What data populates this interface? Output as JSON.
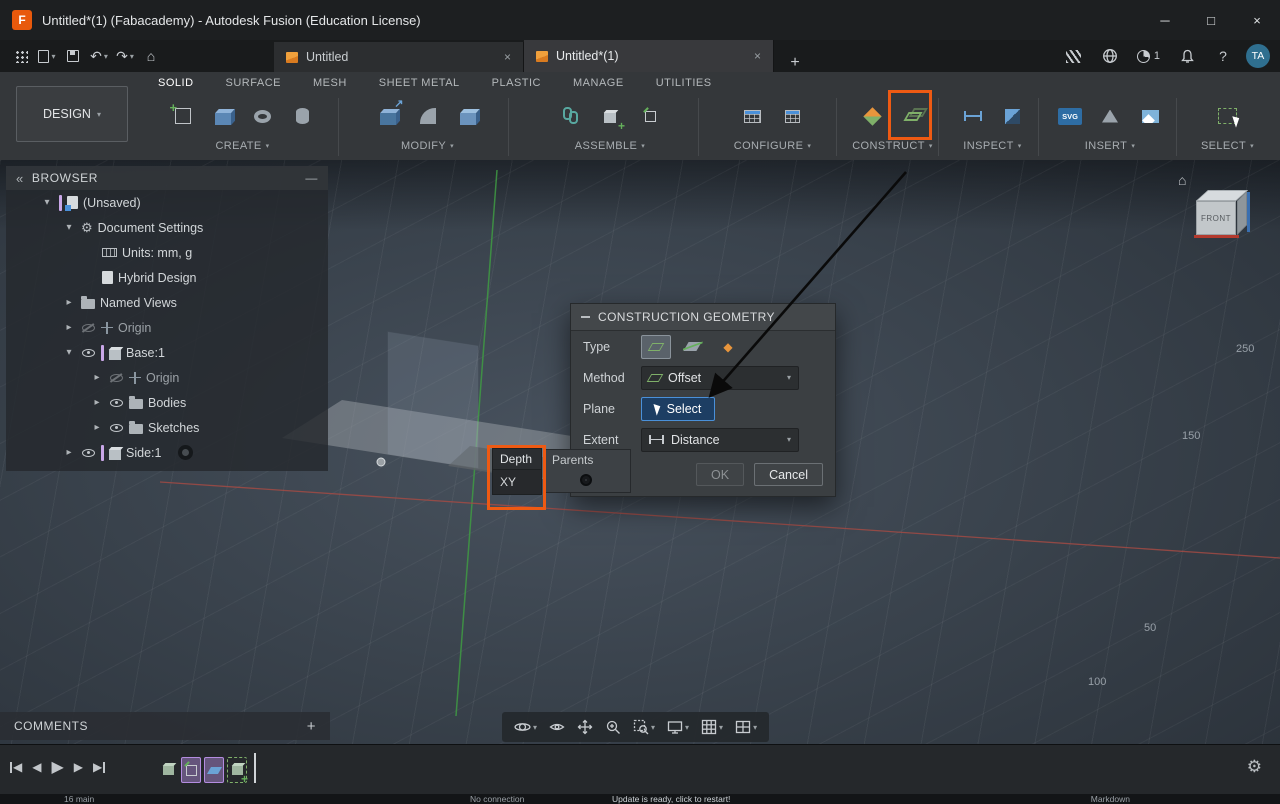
{
  "window": {
    "title": "Untitled*(1) (Fabacademy) - Autodesk Fusion (Education License)",
    "logo_letter": "F"
  },
  "icons": {
    "caret_down": "▾",
    "caret_right": "▸",
    "close": "×",
    "plus": "+",
    "minus": "—",
    "collapse_left": "«",
    "undo": "↶",
    "redo": "↷",
    "home": "⌂",
    "help": "?",
    "gear": "⚙",
    "win_min": "─",
    "win_max": "□",
    "play": "▶",
    "rew": "◀",
    "point": "◆"
  },
  "qat": {
    "tabs": [
      {
        "label": "Untitled"
      },
      {
        "label": "Untitled*(1)"
      }
    ],
    "job_count": "1",
    "avatar": "TA"
  },
  "ribbon": {
    "design_label": "DESIGN",
    "tabs": [
      "SOLID",
      "SURFACE",
      "MESH",
      "SHEET METAL",
      "PLASTIC",
      "MANAGE",
      "UTILITIES"
    ],
    "groups": [
      {
        "label": "CREATE"
      },
      {
        "label": "MODIFY"
      },
      {
        "label": "ASSEMBLE"
      },
      {
        "label": "CONFIGURE"
      },
      {
        "label": "CONSTRUCT"
      },
      {
        "label": "INSPECT"
      },
      {
        "label": "INSERT"
      },
      {
        "label": "SELECT"
      }
    ],
    "svg_badge": "SVG"
  },
  "browser": {
    "header": "BROWSER",
    "items": [
      {
        "label": "(Unsaved)"
      },
      {
        "label": "Document Settings"
      },
      {
        "label": "Units: mm, g"
      },
      {
        "label": "Hybrid Design"
      },
      {
        "label": "Named Views"
      },
      {
        "label": "Origin"
      },
      {
        "label": "Base:1"
      },
      {
        "label": "Origin"
      },
      {
        "label": "Bodies"
      },
      {
        "label": "Sketches"
      },
      {
        "label": "Side:1"
      }
    ]
  },
  "dialog": {
    "title": "CONSTRUCTION GEOMETRY",
    "type_label": "Type",
    "method_label": "Method",
    "method_value": "Offset",
    "plane_label": "Plane",
    "plane_value": "Select",
    "extent_label": "Extent",
    "extent_value": "Distance",
    "ok": "OK",
    "cancel": "Cancel"
  },
  "tooltip": {
    "depth": "Depth",
    "parents": "Parents",
    "xy": "XY"
  },
  "viewport": {
    "viewcube_face": "FRONT",
    "grid_labels": [
      {
        "text": "250"
      },
      {
        "text": "150"
      },
      {
        "text": "50"
      },
      {
        "text": "100"
      }
    ]
  },
  "comments": {
    "label": "COMMENTS"
  },
  "statusbar": {
    "items": [
      {
        "text": "16 main"
      },
      {
        "text": "No connection"
      },
      {
        "text": "Update is ready, click to restart!"
      },
      {
        "text": "Markdown"
      }
    ]
  },
  "colors": {
    "accent_orange": "#ee5a13",
    "select_blue": "#4a90d9",
    "timeline_purple": "#b48ce0"
  }
}
